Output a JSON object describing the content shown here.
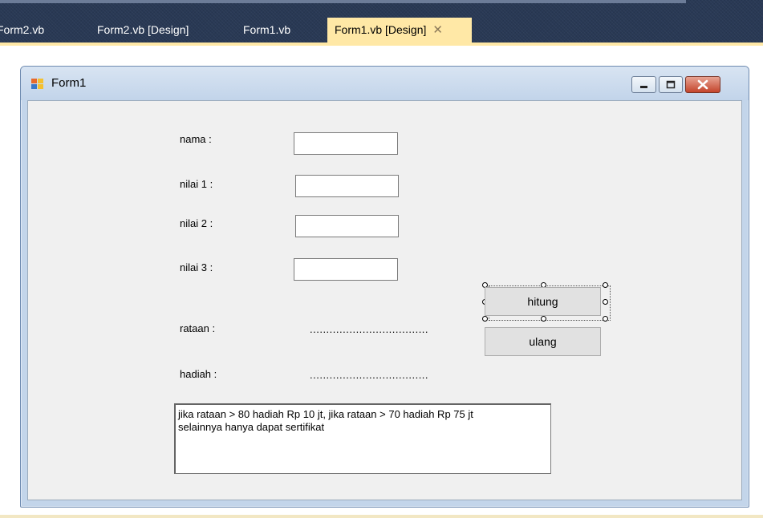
{
  "ide": {
    "tabs": [
      {
        "label": "Form2.vb",
        "active": false
      },
      {
        "label": "Form2.vb [Design]",
        "active": false
      },
      {
        "label": "Form1.vb",
        "active": false
      },
      {
        "label": "Form1.vb [Design]",
        "active": true
      }
    ],
    "close_glyph": "✕"
  },
  "form": {
    "title": "Form1",
    "labels": {
      "nama": "nama :",
      "nilai1": "nilai 1 :",
      "nilai2": "nilai 2 :",
      "nilai3": "nilai 3 :",
      "rataan": "rataan :",
      "hadiah": "hadiah :"
    },
    "inputs": {
      "nama": "",
      "nilai1": "",
      "nilai2": "",
      "nilai3": ""
    },
    "rataan_value": "....................................",
    "hadiah_value": "....................................",
    "buttons": {
      "hitung": "hitung",
      "ulang": "ulang"
    },
    "memo_text": "jika rataan > 80 hadiah Rp 10 jt, jika rataan > 70 hadiah Rp 75 jt\nselainnya hanya dapat sertifikat"
  },
  "colors": {
    "ide_background": "#293955",
    "active_tab": "#ffe8a6",
    "form_frame": "#c3d5ea",
    "client_area": "#f0f0f0",
    "close_button": "#c4452c"
  }
}
